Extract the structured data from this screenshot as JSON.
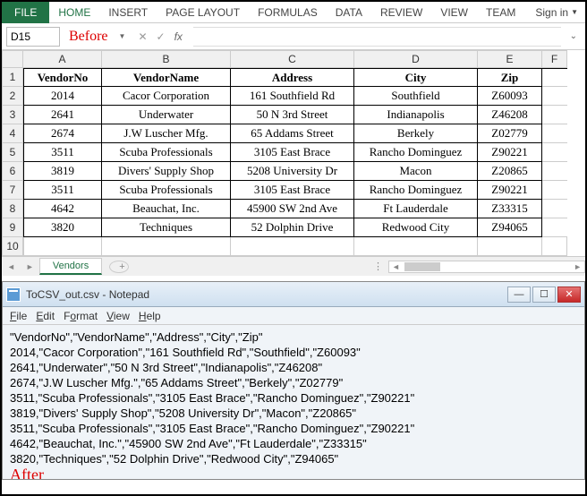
{
  "ribbon": {
    "file": "FILE",
    "tabs": [
      "HOME",
      "INSERT",
      "PAGE LAYOUT",
      "FORMULAS",
      "DATA",
      "REVIEW",
      "VIEW",
      "TEAM"
    ],
    "signin": "Sign in"
  },
  "namebox": "D15",
  "before_label": "Before",
  "after_label": "After",
  "fx": "fx",
  "columns": [
    "A",
    "B",
    "C",
    "D",
    "E",
    "F"
  ],
  "table": {
    "headers": [
      "VendorNo",
      "VendorName",
      "Address",
      "City",
      "Zip"
    ],
    "rows": [
      [
        "2014",
        "Cacor Corporation",
        "161 Southfield Rd",
        "Southfield",
        "Z60093"
      ],
      [
        "2641",
        "Underwater",
        "50 N 3rd Street",
        "Indianapolis",
        "Z46208"
      ],
      [
        "2674",
        "J.W Luscher Mfg.",
        "65 Addams Street",
        "Berkely",
        "Z02779"
      ],
      [
        "3511",
        "Scuba Professionals",
        "3105 East Brace",
        "Rancho Dominguez",
        "Z90221"
      ],
      [
        "3819",
        "Divers' Supply Shop",
        "5208 University Dr",
        "Macon",
        "Z20865"
      ],
      [
        "3511",
        "Scuba Professionals",
        "3105 East Brace",
        "Rancho Dominguez",
        "Z90221"
      ],
      [
        "4642",
        "Beauchat, Inc.",
        "45900 SW 2nd Ave",
        "Ft Lauderdale",
        "Z33315"
      ],
      [
        "3820",
        "Techniques",
        "52 Dolphin Drive",
        "Redwood City",
        "Z94065"
      ]
    ]
  },
  "sheet_tab": "Vendors",
  "notepad": {
    "title": "ToCSV_out.csv - Notepad",
    "menu": [
      "File",
      "Edit",
      "Format",
      "View",
      "Help"
    ],
    "content": "\"VendorNo\",\"VendorName\",\"Address\",\"City\",\"Zip\"\n2014,\"Cacor Corporation\",\"161 Southfield Rd\",\"Southfield\",\"Z60093\"\n2641,\"Underwater\",\"50 N 3rd Street\",\"Indianapolis\",\"Z46208\"\n2674,\"J.W Luscher Mfg.\",\"65 Addams Street\",\"Berkely\",\"Z02779\"\n3511,\"Scuba Professionals\",\"3105 East Brace\",\"Rancho Dominguez\",\"Z90221\"\n3819,\"Divers' Supply Shop\",\"5208 University Dr\",\"Macon\",\"Z20865\"\n3511,\"Scuba Professionals\",\"3105 East Brace\",\"Rancho Dominguez\",\"Z90221\"\n4642,\"Beauchat, Inc.\",\"45900 SW 2nd Ave\",\"Ft Lauderdale\",\"Z33315\"\n3820,\"Techniques\",\"52 Dolphin Drive\",\"Redwood City\",\"Z94065\""
  }
}
